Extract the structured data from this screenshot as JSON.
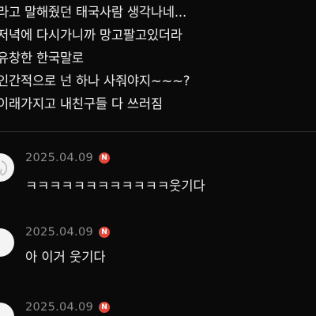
{
  "post": {
    "lines": [
      "라고 말해줬던 태국사람 생각나네...",
      "저녁에 다시가니까 망고팔고있더라",
      "유창한 한국말로",
      "인간적으로 넌 하나 사줘야지~~~?",
      "이래가지고 내친구들 다 쓰러짐"
    ]
  },
  "comments": [
    {
      "date": "2025.04.09",
      "badge": "N",
      "text": "ㅋㅋㅋㅋㅋㅋㅋㅋㅋㅋㅋㅋ웃기다"
    },
    {
      "date": "2025.04.09",
      "badge": "N",
      "text": "아 이거 웃기다"
    },
    {
      "date": "2025.04.09",
      "badge": "N",
      "text": ""
    }
  ]
}
